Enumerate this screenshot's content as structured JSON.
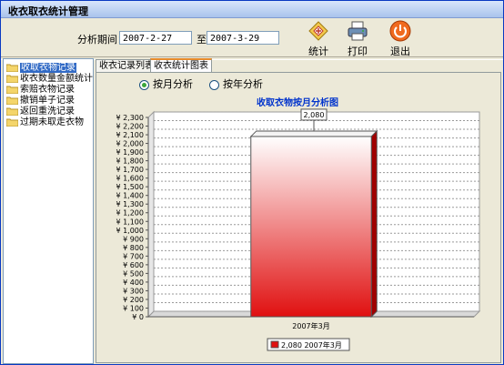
{
  "window": {
    "title": "收衣取衣统计管理"
  },
  "filter": {
    "period_label": "分析期间：",
    "start_date": "2007-2-27",
    "to_label": "至",
    "end_date": "2007-3-29"
  },
  "toolbar": {
    "stats_label": "统计",
    "print_label": "打印",
    "exit_label": "退出"
  },
  "tree": {
    "items": [
      {
        "label": "收取衣物记录",
        "selected": true
      },
      {
        "label": "收衣数量金额统计",
        "selected": false
      },
      {
        "label": "索赔衣物记录",
        "selected": false
      },
      {
        "label": "撤销单子记录",
        "selected": false
      },
      {
        "label": "返回重洗记录",
        "selected": false
      },
      {
        "label": "过期未取走衣物",
        "selected": false
      }
    ]
  },
  "tabs": [
    {
      "label": "收衣记录列表",
      "active": false
    },
    {
      "label": "收衣统计图表",
      "active": true
    }
  ],
  "options": {
    "by_month": "按月分析",
    "by_year": "按年分析",
    "selected": "by_month"
  },
  "colors": {
    "bar": "#e01010",
    "accent": "#0033cc"
  },
  "chart_data": {
    "type": "bar",
    "title": "收取衣物按月分析图",
    "categories": [
      "2007年3月"
    ],
    "values": [
      2080
    ],
    "data_labels": [
      "2,080"
    ],
    "ylim": [
      0,
      2300
    ],
    "ytick_step": 100,
    "ytick_prefix": "¥",
    "grid": true,
    "legend": "bottom",
    "series": [
      {
        "name": "2,080 2007年3月",
        "values": [
          2080
        ]
      }
    ]
  }
}
